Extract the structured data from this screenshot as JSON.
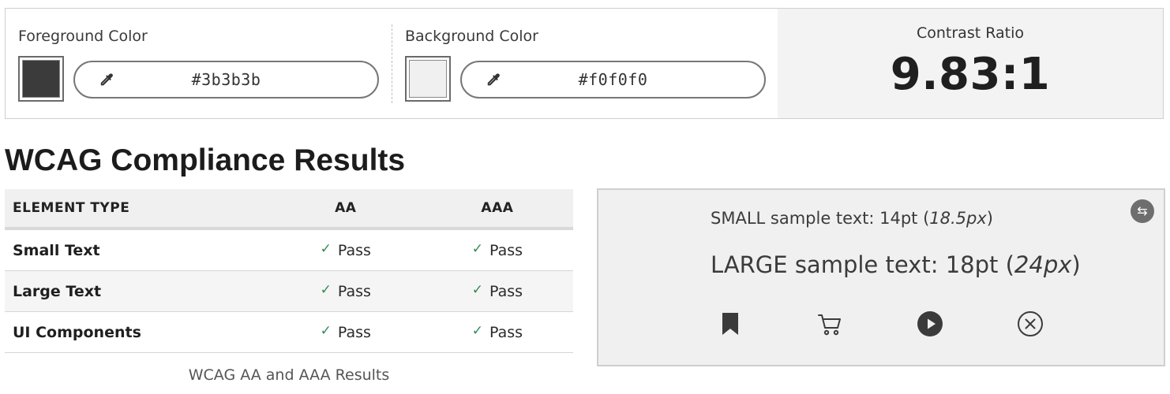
{
  "colors": {
    "foreground": "#3b3b3b",
    "background": "#f0f0f0",
    "pass": "#2e8b57"
  },
  "foreground": {
    "label": "Foreground Color",
    "hex": "#3b3b3b"
  },
  "background": {
    "label": "Background Color",
    "hex": "#f0f0f0"
  },
  "contrast": {
    "label": "Contrast Ratio",
    "value": "9.83:1"
  },
  "results": {
    "title": "WCAG Compliance Results",
    "columns": [
      "ELEMENT TYPE",
      "AA",
      "AAA"
    ],
    "rows": [
      {
        "type": "Small Text",
        "aa": "Pass",
        "aaa": "Pass"
      },
      {
        "type": "Large Text",
        "aa": "Pass",
        "aaa": "Pass"
      },
      {
        "type": "UI Components",
        "aa": "Pass",
        "aaa": "Pass"
      }
    ],
    "caption": "WCAG AA and AAA Results"
  },
  "preview": {
    "small_prefix": "SMALL sample text: 14pt (",
    "small_px": "18.5px",
    "small_suffix": ")",
    "large_prefix": "LARGE sample text: 18pt (",
    "large_px": "24px",
    "large_suffix": ")",
    "icons": [
      "bookmark-icon",
      "cart-icon",
      "play-icon",
      "close-circle-icon"
    ],
    "swap_icon": "swap-icon"
  }
}
